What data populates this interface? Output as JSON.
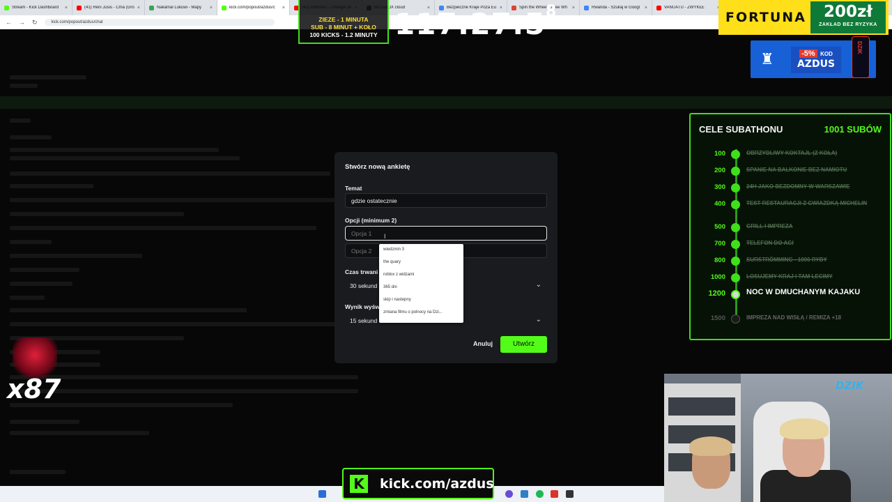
{
  "browser": {
    "tabs": [
      {
        "title": "Stream - Kick Dashboard",
        "color": "#53fc18",
        "active": false
      },
      {
        "title": "(41) Reni Jusis - Ćma (Gro",
        "color": "#ff0000",
        "active": false
      },
      {
        "title": "Nakamal Lukuwi - Mapy",
        "color": "#34a853",
        "active": false
      },
      {
        "title": "kick.com/popout/azdus/c",
        "color": "#53fc18",
        "active": true
      },
      {
        "title": "(41) Deftones - Change (In",
        "color": "#ff0000",
        "active": false
      },
      {
        "title": "BELABOX cloud",
        "color": "#555555",
        "active": false
      },
      {
        "title": "Bezpieczne Kraje Poza Eu",
        "color": "#4285f4",
        "active": false
      },
      {
        "title": "Spin the Wheel - Free Wh",
        "color": "#db4437",
        "active": false
      },
      {
        "title": "Rwanda - Szukaj w Googl",
        "color": "#4285f4",
        "active": false
      },
      {
        "title": "VANUATU - ZWYKŁE",
        "color": "#ff0000",
        "active": false
      }
    ],
    "url": "kick.com/popout/azdus/chat"
  },
  "overlay": {
    "gift_lines": [
      "ZIEZE - 1 MINUTA",
      "SUB - 8 MINUT + KOŁO",
      "100 KICKS - 1.2 MINUTY"
    ],
    "timer": "117:27:5",
    "timer_sup": "8",
    "timer_sub": "9",
    "x87": "x87",
    "kick_url": "kick.com/azdus",
    "kick_logo": "K",
    "webcam_brand": "DZIK"
  },
  "ads": {
    "fortuna_logo": "FORTUNA",
    "fortuna_amount": "200zł",
    "fortuna_sub": "ZAKŁAD BEZ RYZYKA",
    "dzik_pct": "-5%",
    "dzik_kod": "KOD",
    "dzik_code": "AZDUS",
    "dzik_can": "DZIK"
  },
  "goals": {
    "title": "CELE SUBATHONU",
    "count": "1001 SUBÓW",
    "items": [
      {
        "amount": "100",
        "label": "OBRZYDLIWY KOKTAJL (Z KOŁA)",
        "state": "done"
      },
      {
        "amount": "200",
        "label": "SPANIE NA BALKONIE BEZ NAMIOTU",
        "state": "done"
      },
      {
        "amount": "300",
        "label": "24H JAKO BEZDOMNY W WARSZAWIE",
        "state": "done"
      },
      {
        "amount": "400",
        "label": "TEST RESTAURACJI Z GWIAZDKĄ MICHELIN",
        "state": "done"
      },
      {
        "amount": "500",
        "label": "GRILL I IMPREZA",
        "state": "done"
      },
      {
        "amount": "700",
        "label": "TELEFON DO AGI",
        "state": "done"
      },
      {
        "amount": "800",
        "label": "SURSTRÖMMING - 1000 RYBY",
        "state": "done"
      },
      {
        "amount": "1000",
        "label": "LOSUJEMY KRAJ I TAM LECIMY",
        "state": "done"
      },
      {
        "amount": "1200",
        "label": "NOC W DMUCHANYM KAJAKU",
        "state": "current"
      },
      {
        "amount": "1500",
        "label": "IMPREZA NAD WISŁĄ / REMIZA +18",
        "state": "future"
      }
    ]
  },
  "poll": {
    "title": "Stwórz nową ankietę",
    "topic_label": "Temat",
    "topic_value": "gdzie ostatecznie",
    "options_label": "Opcji (minimum 2)",
    "option1_placeholder": "Opcja 1",
    "option2_placeholder": "Opcja 2",
    "duration_label": "Czas trwani",
    "duration_value": "30 sekund",
    "result_label": "Wynik wyśw",
    "result_value": "15 sekund",
    "cancel": "Anuluj",
    "create": "Utwórz"
  },
  "autocomplete": [
    "wiedzmin 3",
    "the quary",
    "roblox z widzami",
    "365 dni",
    "skip i nastepny",
    "zmiana filmu o polnocy na Dzi..."
  ]
}
